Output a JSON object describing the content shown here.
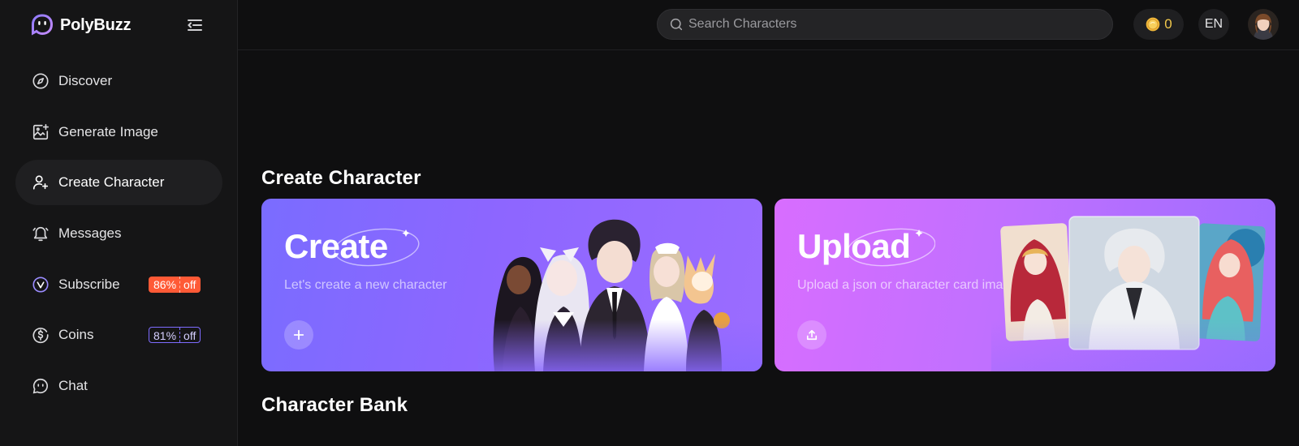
{
  "brand": {
    "name": "PolyBuzz"
  },
  "sidebar": {
    "items": [
      {
        "label": "Discover",
        "icon": "compass-icon"
      },
      {
        "label": "Generate Image",
        "icon": "image-add-icon"
      },
      {
        "label": "Create Character",
        "icon": "user-add-icon",
        "active": true
      },
      {
        "label": "Messages",
        "icon": "bell-icon"
      },
      {
        "label": "Subscribe",
        "icon": "crown-icon",
        "badge": {
          "value": "86%",
          "suffix": "off"
        }
      },
      {
        "label": "Coins",
        "icon": "dollar-coin-icon",
        "badge": {
          "value": "81%",
          "suffix": "off"
        }
      },
      {
        "label": "Chat",
        "icon": "chat-bubble-icon"
      }
    ]
  },
  "header": {
    "search": {
      "placeholder": "Search Characters",
      "value": ""
    },
    "coins": "0",
    "language": "EN"
  },
  "main": {
    "create_section_title": "Create Character",
    "create_card": {
      "title": "Create",
      "subtitle": "Let's create a new character"
    },
    "upload_card": {
      "title": "Upload",
      "subtitle": "Upload a json or character card image file"
    },
    "bank_section_title": "Character Bank"
  },
  "colors": {
    "background": "#0f0f10",
    "sidebar": "#151516",
    "accent": "#7e6cff",
    "badge_hot": "#ff5a36",
    "coin": "#f2c94c"
  }
}
